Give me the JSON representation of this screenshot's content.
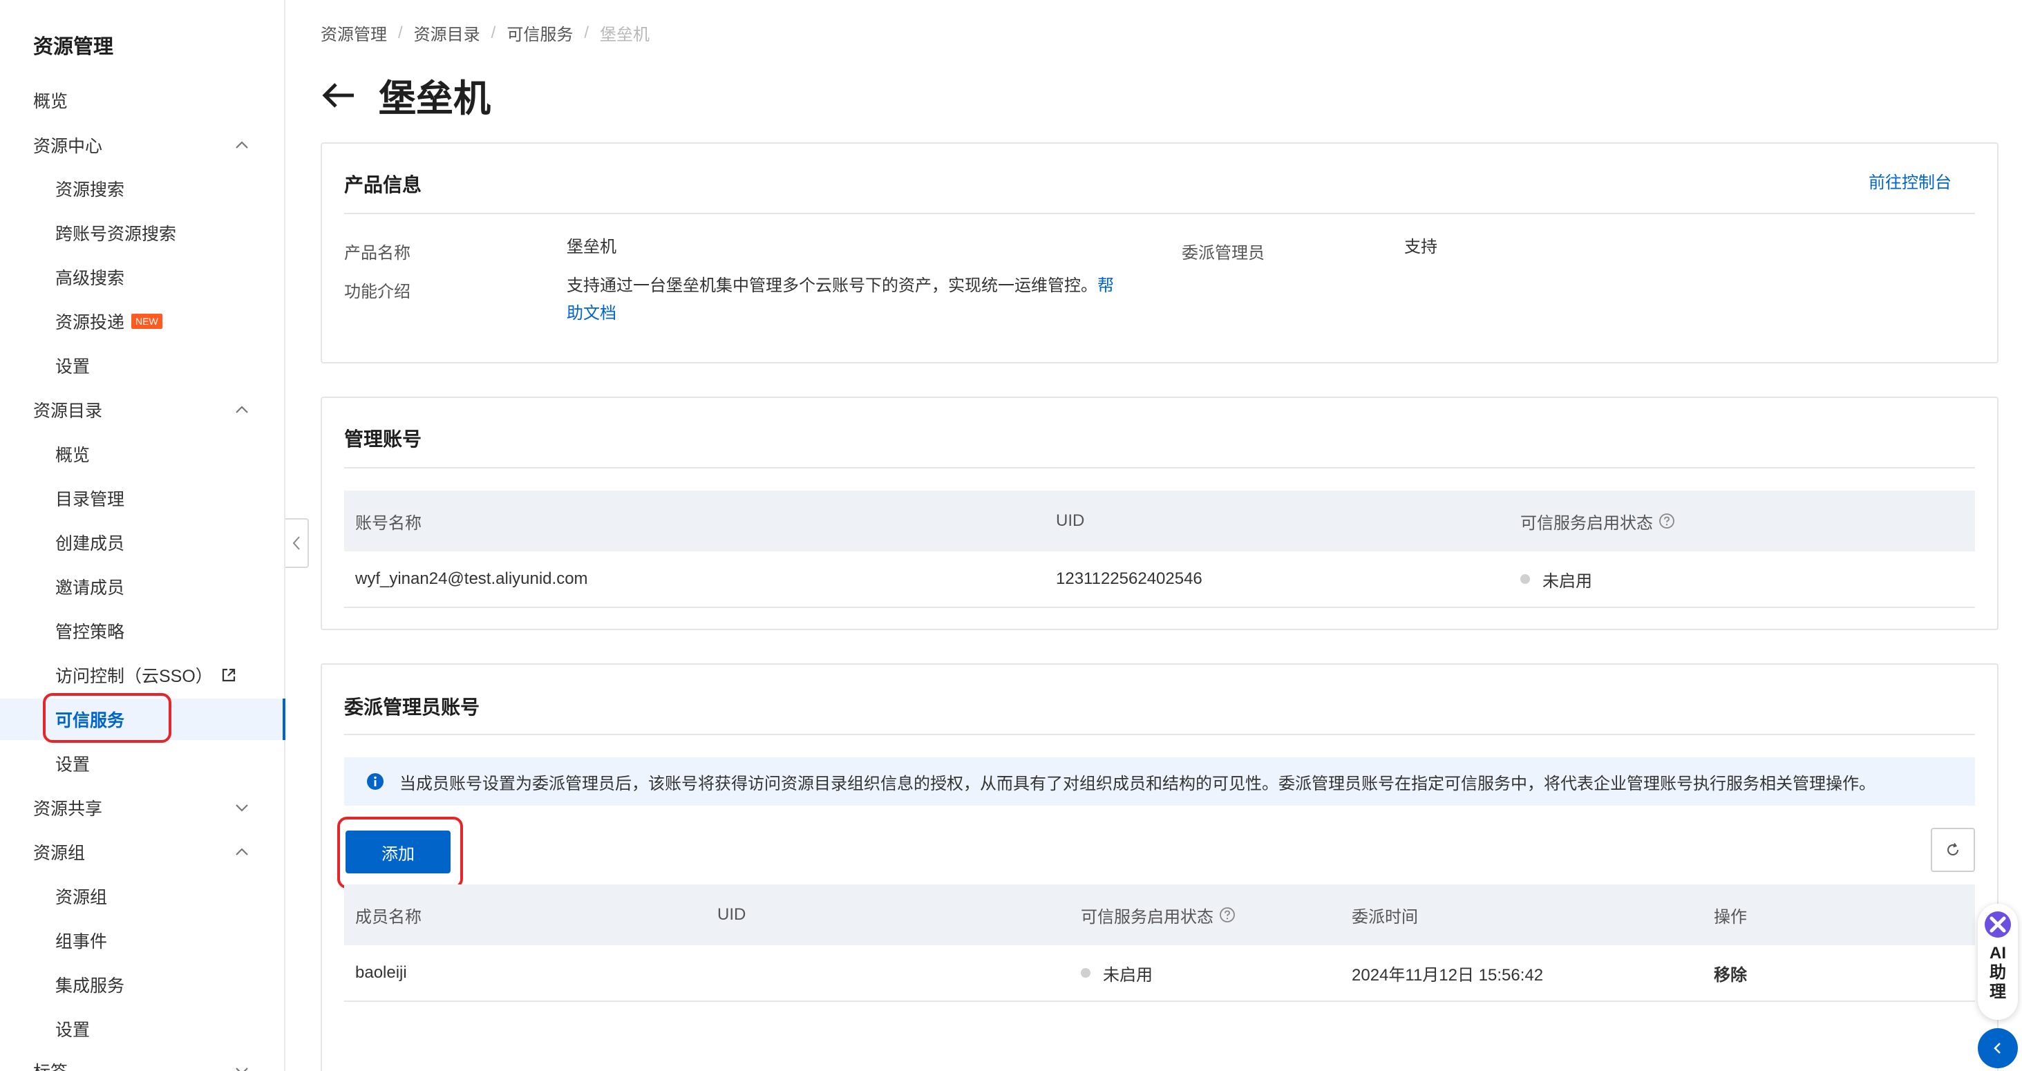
{
  "sidebar": {
    "title": "资源管理",
    "items": [
      {
        "label": "概览"
      },
      {
        "label": "资源中心"
      },
      {
        "label": "资源搜索"
      },
      {
        "label": "跨账号资源搜索"
      },
      {
        "label": "高级搜索"
      },
      {
        "label": "资源投递",
        "badge": "NEW"
      },
      {
        "label": "设置"
      },
      {
        "label": "资源目录"
      },
      {
        "label": "概览"
      },
      {
        "label": "目录管理"
      },
      {
        "label": "创建成员"
      },
      {
        "label": "邀请成员"
      },
      {
        "label": "管控策略"
      },
      {
        "label": "访问控制（云SSO）"
      },
      {
        "label": "可信服务"
      },
      {
        "label": "设置"
      },
      {
        "label": "资源共享"
      },
      {
        "label": "资源组"
      },
      {
        "label": "资源组"
      },
      {
        "label": "组事件"
      },
      {
        "label": "集成服务"
      },
      {
        "label": "设置"
      },
      {
        "label": "标签"
      }
    ]
  },
  "breadcrumb": [
    "资源管理",
    "资源目录",
    "可信服务",
    "堡垒机"
  ],
  "page_title": "堡垒机",
  "product_info": {
    "title": "产品信息",
    "console_link": "前往控制台",
    "name_label": "产品名称",
    "name_value": "堡垒机",
    "delegated_admin_label": "委派管理员",
    "delegated_admin_value": "支持",
    "intro_label": "功能介绍",
    "intro_text": "支持通过一台堡垒机集中管理多个云账号下的资产，实现统一运维管控。",
    "intro_link_1": "帮",
    "intro_link_2": "助文档"
  },
  "mgmt_account": {
    "title": "管理账号",
    "columns": [
      "账号名称",
      "UID",
      "可信服务启用状态"
    ],
    "row": {
      "name": "wyf_yinan24@test.aliyunid.com",
      "uid": "1231122562402546",
      "status": "未启用"
    }
  },
  "delegated_admin": {
    "title": "委派管理员账号",
    "info": "当成员账号设置为委派管理员后，该账号将获得访问资源目录组织信息的授权，从而具有了对组织成员和结构的可见性。委派管理员账号在指定可信服务中，将代表企业管理账号执行服务相关管理操作。",
    "add_button": "添加",
    "columns": [
      "成员名称",
      "UID",
      "可信服务启用状态",
      "委派时间",
      "操作"
    ],
    "row": {
      "name": "baoleiji",
      "uid": "",
      "status": "未启用",
      "time": "2024年11月12日 15:56:42",
      "action": "移除"
    }
  },
  "ai_assistant": {
    "label": "AI助理"
  },
  "colors": {
    "primary": "#0064c8",
    "highlight": "#e5252a",
    "badge": "#ff5a1f"
  }
}
